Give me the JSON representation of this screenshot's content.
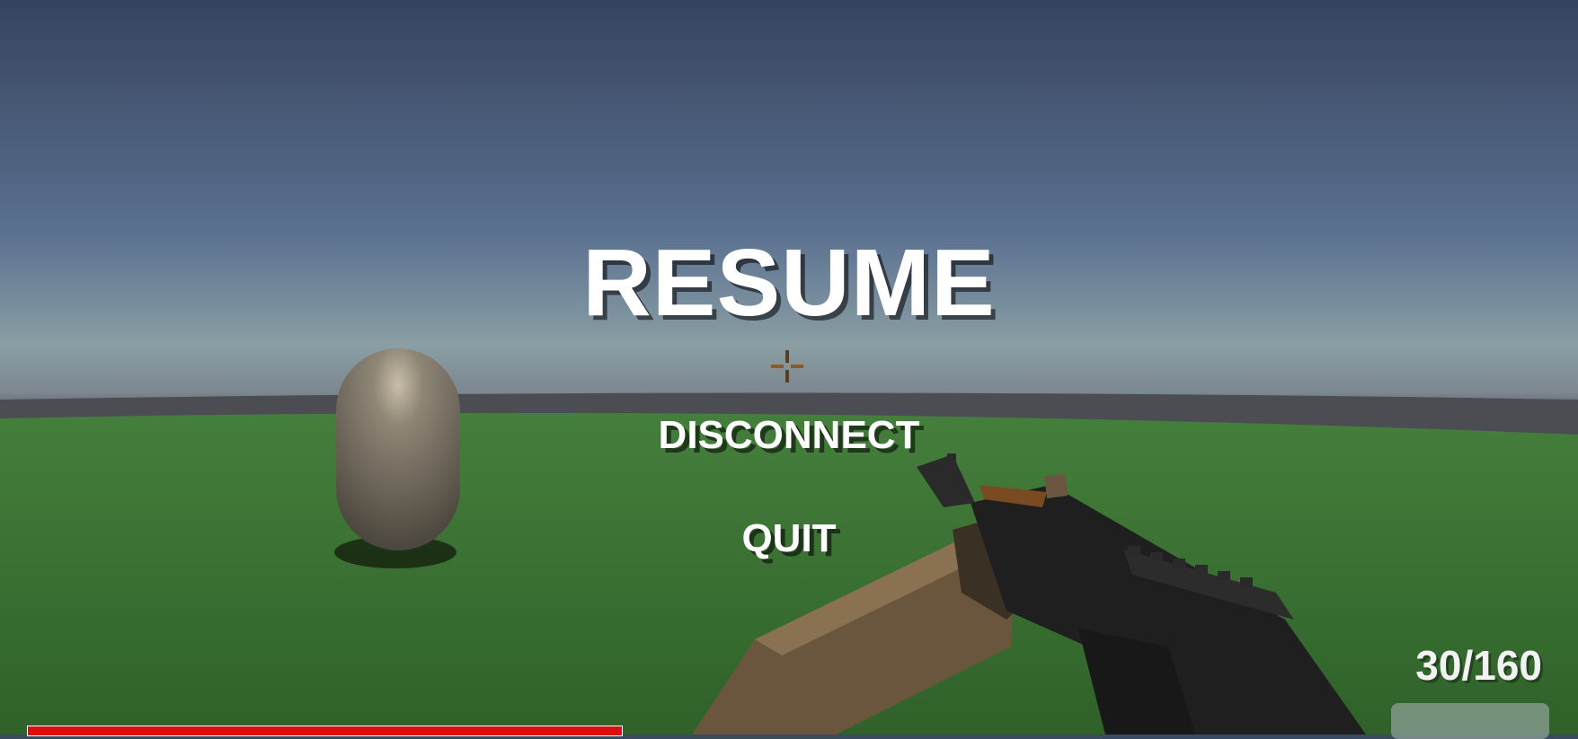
{
  "menu": {
    "resume_label": "RESUME",
    "disconnect_label": "DISCONNECT",
    "quit_label": "QUIT"
  },
  "hud": {
    "ammo": "30/160",
    "health_fraction": 1.0
  },
  "colors": {
    "health": "#d81010",
    "menu_text": "#ffffff",
    "ground": "#3b7a37"
  }
}
